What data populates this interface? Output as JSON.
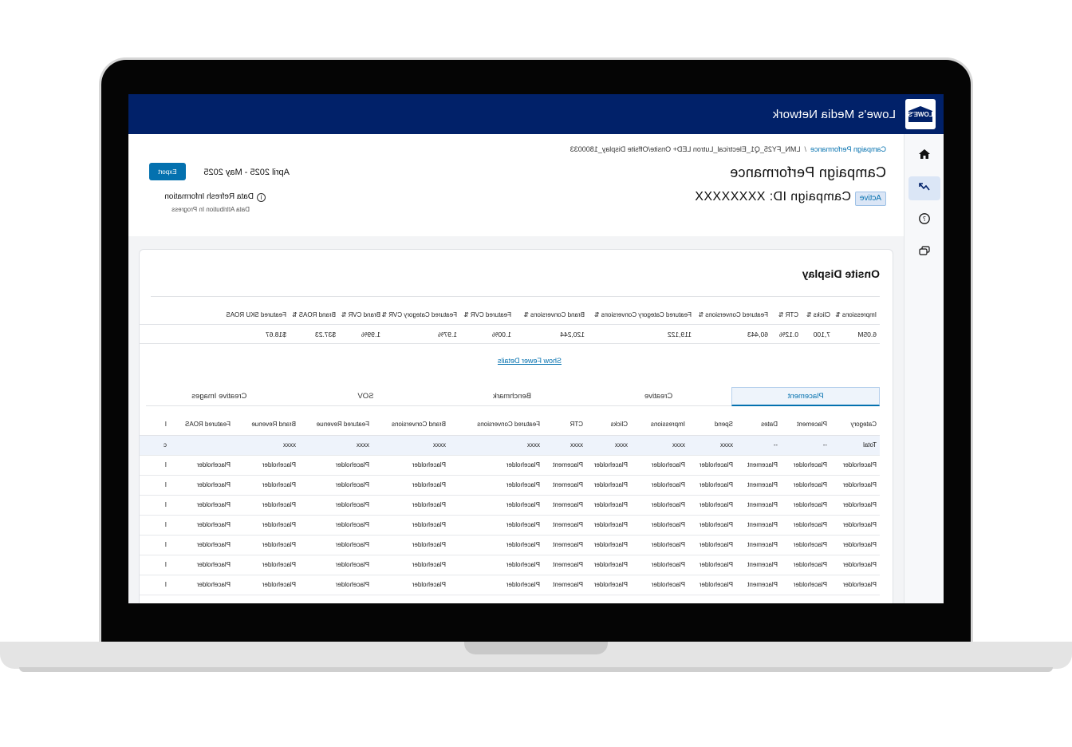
{
  "app": {
    "logo_text": "LOWE'S",
    "title": "Lowe's Media Network"
  },
  "sidebar": {
    "items": [
      {
        "name": "home-icon",
        "glyph": "⌂",
        "active": false
      },
      {
        "name": "trend-icon",
        "glyph": "↗",
        "active": true
      },
      {
        "name": "help-icon",
        "glyph": "?",
        "active": false
      },
      {
        "name": "chat-icon",
        "glyph": "▭",
        "active": false
      }
    ]
  },
  "header": {
    "breadcrumb_link": "Campaign Performance",
    "breadcrumb_separator": "/",
    "breadcrumb_current": "LMN_FY25_Q1_Electrical_Lutron LED+ Onsite/Offsite Display_1800033",
    "title": "Campaign Performance",
    "status": "Active",
    "campaign_id": "Campaign ID: XXXXXXXX",
    "date_range": "April 2025 - May 2025",
    "export_label": "Export",
    "refresh_title": "Data Refresh Information",
    "refresh_sub": "Data Attribution In Progress"
  },
  "section": {
    "title": "Onsite Display",
    "toggle_link": "Show Fewer Details"
  },
  "metrics": {
    "headers": [
      "Impressions",
      "Clicks",
      "CTR",
      "Featured Conversions",
      "Featured Category Conversions",
      "Brand Conversions",
      "Featured CVR",
      "Featured Category CVR",
      "Brand CVR",
      "Brand ROAS",
      "Featured SKU ROAS"
    ],
    "values": [
      "6.05M",
      "7,100",
      "0.12%",
      "60,443",
      "119,122",
      "120,244",
      "1.00%",
      "1.97%",
      "1.99%",
      "$37.23",
      "$18.67"
    ]
  },
  "tabs": [
    "Placement",
    "Creative",
    "Benchmark",
    "SOV",
    "Creative Images"
  ],
  "table": {
    "columns": [
      "Category",
      "Placement",
      "Dates",
      "Spend",
      "Impressions",
      "Clicks",
      "CTR",
      "Featured Conversions",
      "Brand Conversions",
      "Featured Revenue",
      "Brand Revenue",
      "Featured ROAS",
      "I"
    ],
    "total_row": [
      "Total",
      "--",
      "--",
      "xxxx",
      "xxxx",
      "xxxx",
      "xxxx",
      "xxxx",
      "xxxx",
      "xxxx",
      "xxxx",
      "",
      "c"
    ],
    "rows": [
      [
        "Placeholder",
        "Placeholder",
        "Placement",
        "Placeholder",
        "Placeholder",
        "Placeholder",
        "Placement",
        "Placeholder",
        "Placeholder",
        "Placeholder",
        "Placeholder",
        "Placeholder",
        "I"
      ],
      [
        "Placeholder",
        "Placeholder",
        "Placement",
        "Placeholder",
        "Placeholder",
        "Placeholder",
        "Placement",
        "Placeholder",
        "Placeholder",
        "Placeholder",
        "Placeholder",
        "Placeholder",
        "I"
      ],
      [
        "Placeholder",
        "Placeholder",
        "Placement",
        "Placeholder",
        "Placeholder",
        "Placeholder",
        "Placement",
        "Placeholder",
        "Placeholder",
        "Placeholder",
        "Placeholder",
        "Placeholder",
        "I"
      ],
      [
        "Placeholder",
        "Placeholder",
        "Placement",
        "Placeholder",
        "Placeholder",
        "Placeholder",
        "Placement",
        "Placeholder",
        "Placeholder",
        "Placeholder",
        "Placeholder",
        "Placeholder",
        "I"
      ],
      [
        "Placeholder",
        "Placeholder",
        "Placement",
        "Placeholder",
        "Placeholder",
        "Placeholder",
        "Placement",
        "Placeholder",
        "Placeholder",
        "Placeholder",
        "Placeholder",
        "Placeholder",
        "I"
      ],
      [
        "Placeholder",
        "Placeholder",
        "Placement",
        "Placeholder",
        "Placeholder",
        "Placeholder",
        "Placement",
        "Placeholder",
        "Placeholder",
        "Placeholder",
        "Placeholder",
        "Placeholder",
        "I"
      ],
      [
        "Placeholder",
        "Placeholder",
        "Placement",
        "Placeholder",
        "Placeholder",
        "Placeholder",
        "Placement",
        "Placeholder",
        "Placeholder",
        "Placeholder",
        "Placeholder",
        "Placeholder",
        "I"
      ]
    ]
  },
  "colors": {
    "brand_navy": "#012169",
    "accent_blue": "#0471af",
    "active_bg": "#dbe6f6"
  }
}
